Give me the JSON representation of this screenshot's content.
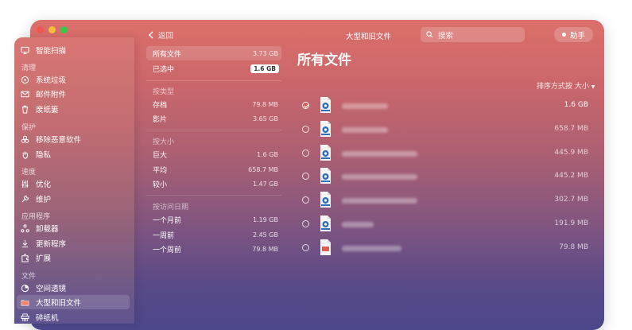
{
  "window": {
    "title": "大型和旧文件"
  },
  "topbar": {
    "back_label": "返回",
    "search_placeholder": "搜索",
    "assistant_label": "助手"
  },
  "sidebar": {
    "top_item": {
      "label": "智能扫描",
      "icon": "monitor-icon"
    },
    "sections": [
      {
        "title": "清理",
        "items": [
          {
            "label": "系统垃圾",
            "icon": "disk-icon"
          },
          {
            "label": "邮件附件",
            "icon": "mail-icon"
          },
          {
            "label": "废纸篓",
            "icon": "trash-icon"
          }
        ]
      },
      {
        "title": "保护",
        "items": [
          {
            "label": "移除恶意软件",
            "icon": "biohazard-icon"
          },
          {
            "label": "隐私",
            "icon": "hand-icon"
          }
        ]
      },
      {
        "title": "速度",
        "items": [
          {
            "label": "优化",
            "icon": "sliders-icon"
          },
          {
            "label": "维护",
            "icon": "wrench-icon"
          }
        ]
      },
      {
        "title": "应用程序",
        "items": [
          {
            "label": "卸载器",
            "icon": "apps-icon"
          },
          {
            "label": "更新程序",
            "icon": "update-icon"
          },
          {
            "label": "扩展",
            "icon": "puzzle-icon"
          }
        ]
      },
      {
        "title": "文件",
        "items": [
          {
            "label": "空间透镜",
            "icon": "lens-icon"
          },
          {
            "label": "大型和旧文件",
            "icon": "folder-icon",
            "active": true
          },
          {
            "label": "碎纸机",
            "icon": "shredder-icon"
          }
        ]
      }
    ]
  },
  "filters": {
    "all_files": {
      "label": "所有文件",
      "value": "3.73 GB"
    },
    "selected": {
      "label": "已选中",
      "value": "1.6 GB"
    },
    "by_type": {
      "title": "按类型",
      "items": [
        {
          "label": "存档",
          "value": "79.8 MB"
        },
        {
          "label": "影片",
          "value": "3.65 GB"
        }
      ]
    },
    "by_size": {
      "title": "按大小",
      "items": [
        {
          "label": "巨大",
          "value": "1.6 GB"
        },
        {
          "label": "平均",
          "value": "658.7 MB"
        },
        {
          "label": "较小",
          "value": "1.47 GB"
        }
      ]
    },
    "by_access": {
      "title": "按访问日期",
      "items": [
        {
          "label": "一个月前",
          "value": "1.19 GB"
        },
        {
          "label": "一周前",
          "value": "2.45 GB"
        },
        {
          "label": "一个周前",
          "value": "79.8 MB"
        }
      ]
    }
  },
  "main": {
    "title": "所有文件",
    "sort_label": "排序方式按 大小",
    "files": [
      {
        "size": "1.6 GB",
        "checked": true,
        "kind": "movie",
        "name_width": 58
      },
      {
        "size": "658.7 MB",
        "checked": false,
        "kind": "movie",
        "name_width": 58
      },
      {
        "size": "445.9 MB",
        "checked": false,
        "kind": "movie",
        "name_width": 95
      },
      {
        "size": "445.2 MB",
        "checked": false,
        "kind": "movie",
        "name_width": 95
      },
      {
        "size": "302.7 MB",
        "checked": false,
        "kind": "movie",
        "name_width": 95
      },
      {
        "size": "191.9 MB",
        "checked": false,
        "kind": "movie",
        "name_width": 40
      },
      {
        "size": "79.8 MB",
        "checked": false,
        "kind": "pdf",
        "name_width": 75
      }
    ]
  },
  "colors": {
    "accent": "#e0534e"
  }
}
